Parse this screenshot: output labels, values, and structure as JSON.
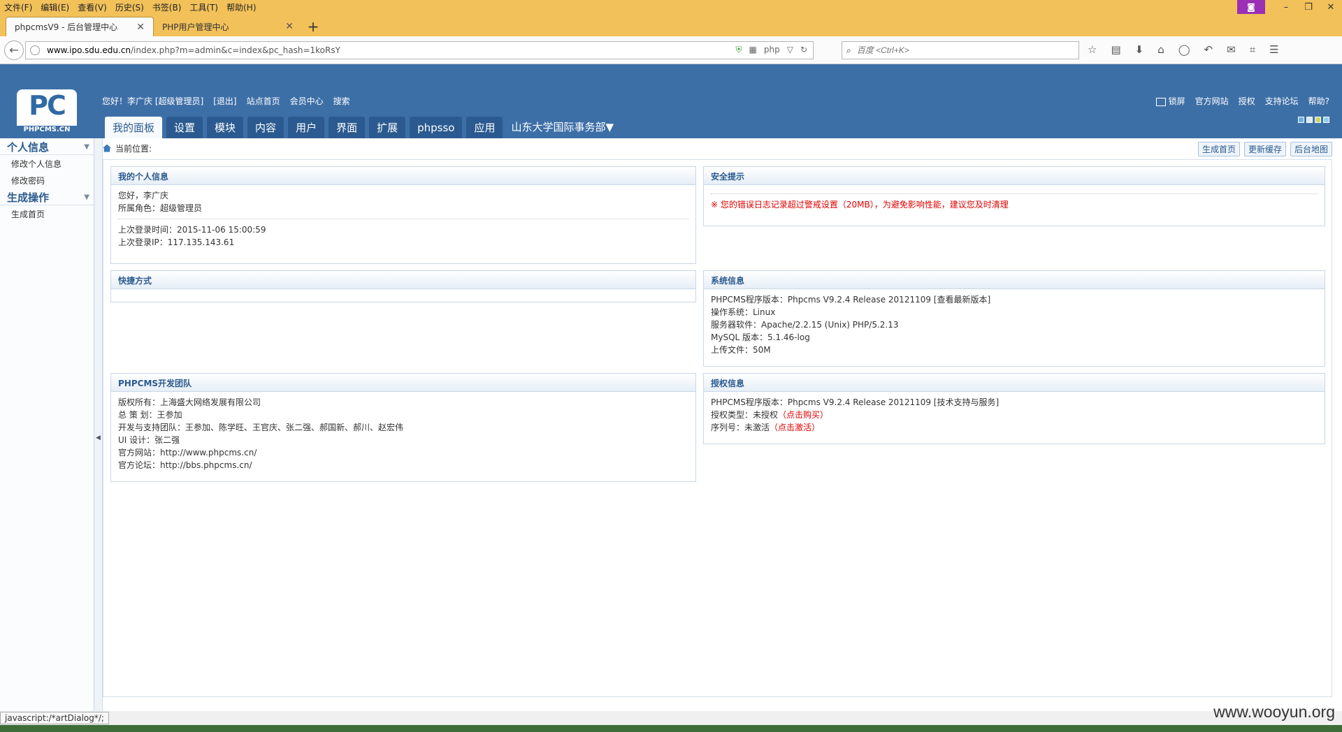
{
  "browser": {
    "menu": [
      "文件(F)",
      "编辑(E)",
      "查看(V)",
      "历史(S)",
      "书签(B)",
      "工具(T)",
      "帮助(H)"
    ],
    "tabs": [
      {
        "label": "phpcmsV9 - 后台管理中心",
        "active": true
      },
      {
        "label": "PHP用户管理中心",
        "active": false
      }
    ],
    "url_host": "www.ipo.sdu.edu.cn",
    "url_path": "/index.php?m=admin&c=index&pc_hash=1koRsY",
    "url_php_badge": "php",
    "search_placeholder": "百度 <Ctrl+K>",
    "status_link": "javascript:/*artDialog*/;"
  },
  "header": {
    "logo_text": "PC",
    "logo_sub": "PHPCMS.CN",
    "user_greeting": "您好！李广庆 [超级管理员]",
    "logout": "[退出]",
    "site_home": "站点首页",
    "member_center": "会员中心",
    "search": "搜索",
    "lock": "锁屏",
    "official_site": "官方网站",
    "authorize": "授权",
    "support_forum": "支持论坛",
    "help": "帮助?",
    "skin_colors": [
      "#6ab0e8",
      "#d8e8f6",
      "#c8d86a",
      "#8fd0e8"
    ]
  },
  "tabs": [
    "我的面板",
    "设置",
    "模块",
    "内容",
    "用户",
    "界面",
    "扩展",
    "phpsso",
    "应用"
  ],
  "site_select": "山东大学国际事务部",
  "sidebar": {
    "groups": [
      {
        "title": "个人信息",
        "items": [
          "修改个人信息",
          "修改密码"
        ]
      },
      {
        "title": "生成操作",
        "items": [
          "生成首页"
        ]
      }
    ]
  },
  "breadcrumb": {
    "label": "当前位置:",
    "buttons": [
      "生成首页",
      "更新缓存",
      "后台地图"
    ]
  },
  "panels": {
    "personal": {
      "title": "我的个人信息",
      "hello": "您好，李广庆",
      "role": "所属角色：超级管理员",
      "last_time": "上次登录时间：2015-11-06 15:00:59",
      "last_ip": "上次登录IP：117.135.143.61"
    },
    "security": {
      "title": "安全提示",
      "warning": "※ 您的错误日志记录超过警戒设置（20MB），为避免影响性能，建议您及时清理"
    },
    "shortcuts": {
      "title": "快捷方式"
    },
    "system": {
      "title": "系统信息",
      "lines": [
        "PHPCMS程序版本：Phpcms V9.2.4 Release 20121109 [查看最新版本]",
        "操作系统：Linux",
        "服务器软件：Apache/2.2.15 (Unix) PHP/5.2.13",
        "MySQL 版本：5.1.46-log",
        "上传文件：50M"
      ]
    },
    "team": {
      "title": "PHPCMS开发团队",
      "lines": [
        "版权所有：上海盛大网络发展有限公司",
        "总 策 划：王参加",
        "开发与支持团队：王参加、陈学旺、王官庆、张二强、郝国新、郝川、赵宏伟",
        "UI 设计：张二强",
        "官方网站：http://www.phpcms.cn/",
        "官方论坛：http://bbs.phpcms.cn/"
      ]
    },
    "license": {
      "title": "授权信息",
      "version": "PHPCMS程序版本：Phpcms V9.2.4 Release 20121109 [技术支持与服务]",
      "type_label": "授权类型：未授权",
      "type_link": "（点击购买）",
      "serial_label": "序列号：未激活",
      "serial_link": "（点击激活）"
    }
  },
  "watermark": "www.wooyun.org"
}
